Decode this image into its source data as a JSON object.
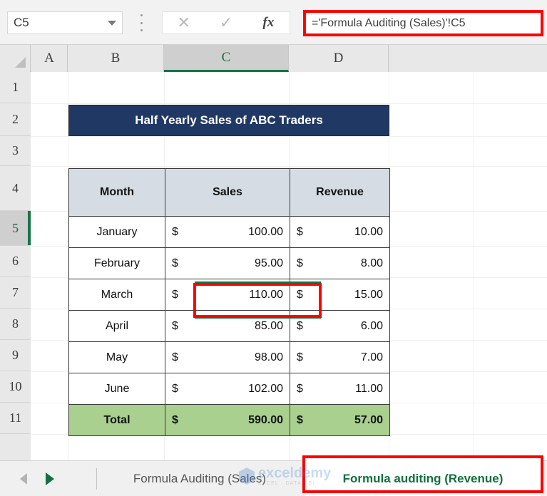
{
  "formula_bar": {
    "name_box_value": "C5",
    "cancel_icon": "close-x-icon",
    "enter_icon": "checkmark-icon",
    "function_icon": "fx",
    "formula_value": "='Formula Auditing (Sales)'!C5"
  },
  "grid": {
    "column_headers": [
      "A",
      "B",
      "C",
      "D"
    ],
    "selected_column": "C",
    "row_headers": [
      "1",
      "2",
      "3",
      "4",
      "5",
      "6",
      "7",
      "8",
      "9",
      "10",
      "11"
    ],
    "selected_row": "5"
  },
  "sheet_content": {
    "title_banner": "Half Yearly Sales of ABC Traders",
    "table_headers": [
      "Month",
      "Sales",
      "Revenue"
    ],
    "currency_symbol": "$",
    "rows": [
      {
        "month": "January",
        "sales": "100.00",
        "revenue": "10.00"
      },
      {
        "month": "February",
        "sales": "95.00",
        "revenue": "8.00"
      },
      {
        "month": "March",
        "sales": "110.00",
        "revenue": "15.00"
      },
      {
        "month": "April",
        "sales": "85.00",
        "revenue": "6.00"
      },
      {
        "month": "May",
        "sales": "98.00",
        "revenue": "7.00"
      },
      {
        "month": "June",
        "sales": "102.00",
        "revenue": "11.00"
      }
    ],
    "total": {
      "label": "Total",
      "sales": "590.00",
      "revenue": "57.00"
    }
  },
  "sheet_tabs": {
    "inactive_tab": "Formula Auditing (Sales)",
    "active_tab": "Formula auditing (Revenue)",
    "prev_arrow_icon": "arrow-left-icon",
    "next_arrow_icon": "arrow-right-icon"
  },
  "watermark": {
    "brand": "exceldemy",
    "tagline": "EXCEL · DATA · BI"
  },
  "colors": {
    "banner_navy": "#203864",
    "header_fill": "#D6DCE4",
    "total_green": "#A9D08E",
    "annotation_red": "#FD0000",
    "selection_green": "#157347",
    "tab_active_green": "#12703C"
  }
}
